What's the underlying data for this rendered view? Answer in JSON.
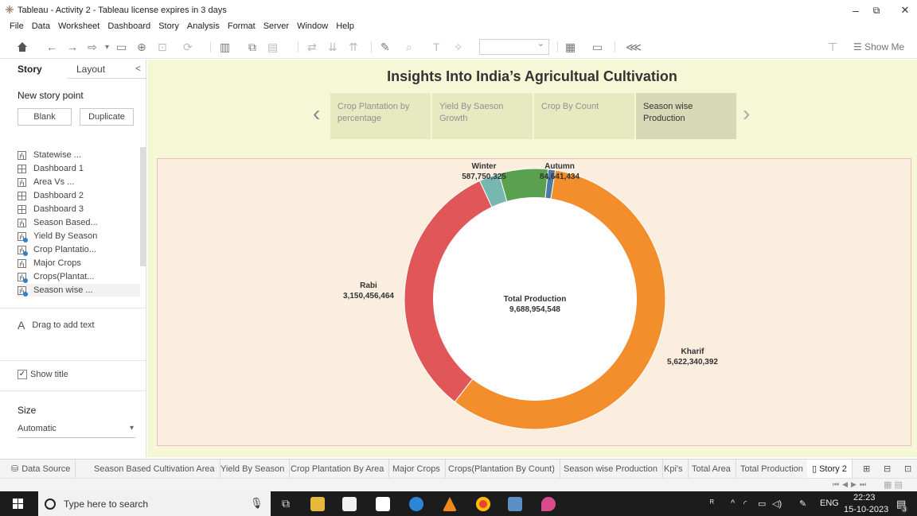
{
  "window": {
    "title": "Tableau - Activity 2 - Tableau license expires in 3 days",
    "controls": {
      "minimize": "–",
      "restore": "⧉",
      "close": "✕"
    }
  },
  "menu": [
    "File",
    "Data",
    "Worksheet",
    "Dashboard",
    "Story",
    "Analysis",
    "Format",
    "Server",
    "Window",
    "Help"
  ],
  "toolbar": {
    "show_me": "Show Me"
  },
  "left_panel": {
    "tab_story": "Story",
    "tab_layout": "Layout",
    "collapse": "<",
    "new_story_point": "New story point",
    "blank_button": "Blank",
    "duplicate_button": "Duplicate",
    "sheets": [
      {
        "label": "Statewise ...",
        "icon": "sheet-icon"
      },
      {
        "label": "Dashboard 1",
        "icon": "dashboard-icon"
      },
      {
        "label": "Area Vs ...",
        "icon": "sheet-icon"
      },
      {
        "label": "Dashboard 2",
        "icon": "dashboard-icon"
      },
      {
        "label": "Dashboard 3",
        "icon": "dashboard-icon"
      },
      {
        "label": "Season Based...",
        "icon": "sheet-icon"
      },
      {
        "label": "Yield By Season",
        "icon": "sheet-used-icon"
      },
      {
        "label": "Crop Plantatio...",
        "icon": "sheet-used-icon"
      },
      {
        "label": "Major Crops",
        "icon": "sheet-icon"
      },
      {
        "label": "Crops(Plantat...",
        "icon": "sheet-used-icon"
      },
      {
        "label": "Season wise ...",
        "icon": "sheet-used-icon"
      }
    ],
    "drag_text": "Drag to add text",
    "show_title": "Show title",
    "show_title_checked": true,
    "size_label": "Size",
    "size_value": "Automatic"
  },
  "story": {
    "title": "Insights Into India’s Agricultual Cultivation",
    "points": [
      {
        "label": "Crop Plantation by percentage",
        "active": false
      },
      {
        "label": "Yield By Saeson Growth",
        "active": false
      },
      {
        "label": "Crop By Count",
        "active": false
      },
      {
        "label": "Season wise Production",
        "active": true
      }
    ]
  },
  "chart_data": {
    "type": "pie",
    "donut": true,
    "center_label": "Total Production",
    "center_value": "9,688,954,548",
    "slices": [
      {
        "name": "Kharif",
        "value": 5622340392,
        "display": "5,622,340,392",
        "color": "#f28e2b"
      },
      {
        "name": "Rabi",
        "value": 3150456464,
        "display": "3,150,456,464",
        "color": "#e15759"
      },
      {
        "name": "",
        "value": 244000000,
        "display": "",
        "color": "#76b7b2"
      },
      {
        "name": "Winter",
        "value": 587750325,
        "display": "587,750,325",
        "color": "#59a14f"
      },
      {
        "name": "Autumn",
        "value": 84641434,
        "display": "84,641,434",
        "color": "#4e79a7"
      }
    ]
  },
  "sheet_tabs": [
    {
      "label": "Data Source",
      "active": false
    },
    {
      "label": "Season Based Cultivation Area",
      "active": false
    },
    {
      "label": "Yield By Season",
      "active": false
    },
    {
      "label": "Crop Plantation By Area",
      "active": false
    },
    {
      "label": "Major Crops",
      "active": false
    },
    {
      "label": "Crops(Plantation By Count)",
      "active": false
    },
    {
      "label": "Season wise Production",
      "active": false
    },
    {
      "label": "Kpi's",
      "active": false
    },
    {
      "label": "Total Area",
      "active": false
    },
    {
      "label": "Total Production",
      "active": false
    },
    {
      "label": "Story 2",
      "active": true
    }
  ],
  "taskbar": {
    "search_placeholder": "Type here to search",
    "language": "ENG",
    "time": "22:23",
    "date": "15-10-2023",
    "notifications": "3"
  }
}
